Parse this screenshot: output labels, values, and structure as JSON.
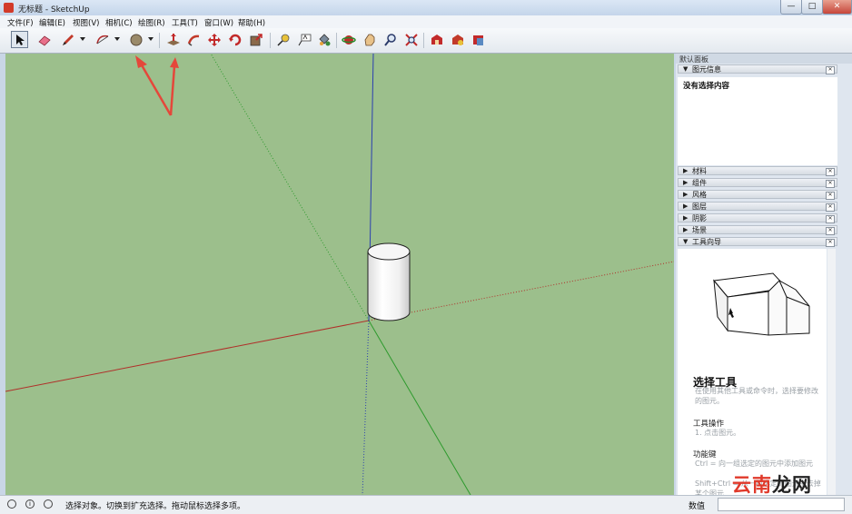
{
  "window": {
    "title": "无标题 - SketchUp",
    "min": "—",
    "max": "□",
    "close": "✕"
  },
  "menu": [
    "文件(F)",
    "编辑(E)",
    "视图(V)",
    "相机(C)",
    "绘图(R)",
    "工具(T)",
    "窗口(W)",
    "帮助(H)"
  ],
  "panel": {
    "title": "默认面板",
    "entity_info": {
      "label": "图元信息",
      "status": "没有选择内容"
    },
    "sections": [
      "材料",
      "组件",
      "风格",
      "图层",
      "阴影",
      "场景"
    ],
    "instructor": {
      "label": "工具向导",
      "title": "选择工具",
      "desc": "在使用其他工具或命令时，选择要修改的图元。",
      "ops_heading": "工具操作",
      "ops_1": "1.   点击图元。",
      "keys_heading": "功能键",
      "keys_1": "Ctrl = 向一组选定的图元中添加图元",
      "keys_2": "Shift+Ctrl = 从一组选定的图元中去掉某个图元"
    }
  },
  "status": {
    "text": "选择对象。切换到扩充选择。拖动鼠标选择多项。",
    "measure_label": "数值",
    "icon_info": "i"
  },
  "watermark": {
    "red": "云南",
    "dark": "龙网"
  },
  "colors": {
    "viewport": "#9cbf8c",
    "arrow": "#e5473a",
    "red_axis": "#b0302a",
    "green_axis": "#2d9a2d",
    "blue_axis": "#2b3fb0"
  }
}
